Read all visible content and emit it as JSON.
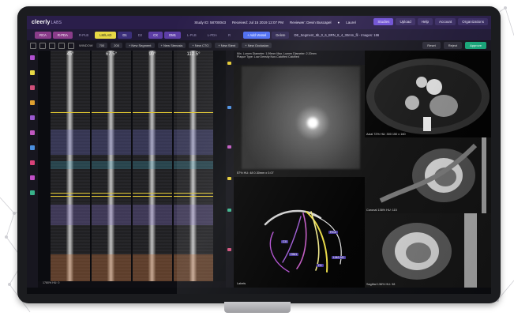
{
  "app": {
    "logo": "cleerly",
    "logo_suffix": "LABS",
    "study": "Study ID: 58700043",
    "received": "Received: Jul 15 2019 12:07 PM",
    "reviewer": "Reviewer: Devin Buscapel",
    "user": "Laurel"
  },
  "top_buttons": [
    "Studies",
    "Upload",
    "Help",
    "Account",
    "Organizations"
  ],
  "vessel_tabs": [
    "RCA",
    "R-PDA",
    "R-PLB",
    "LM/LAD",
    "D1",
    "D2",
    "CX",
    "OM1",
    "L-PLB",
    "L-PDA",
    "R"
  ],
  "tab_actions": {
    "add_vessel": "+ Add Vessel",
    "delete": "Delete",
    "series": "DE_Segment_6b_0_6_BRN_8_4_30mm_fil - Images: 186"
  },
  "toolbar": {
    "window": "WINDOW",
    "w": "700",
    "l": "200",
    "actions": [
      "+ New Segment",
      "+ New Stenosis",
      "+ New CTO",
      "+ New Stent",
      "+ New Occlusion"
    ],
    "right": [
      "Reset",
      "Reject",
      "Approve"
    ]
  },
  "cpr": {
    "angles": [
      "45°",
      "67.5°",
      "90°",
      "112.5°"
    ],
    "footer": "1780% HU: 0"
  },
  "cross_section": {
    "line1": "Min. Lumen Diameter: 1.99mm   Max. Lumen Diameter: 2.20mm",
    "line2": "Plaque Type:  Low Density   Non-Calcified   Calcified",
    "footer": "57%  HU: 48   0.30mm x 0.07"
  },
  "tree": {
    "labels": [
      "RCA",
      "LM/LAD",
      "CX",
      "OM1",
      "D1"
    ],
    "footer": "Labels"
  },
  "axial": {
    "caption": "Axial   72%  HU: 300   150 x 160"
  },
  "coronal": {
    "caption": "Coronal   136%  HU: 115"
  },
  "sagittal": {
    "caption": "Sagittal   136%  HU: 98"
  },
  "colors": {
    "accent": "#6d4fd3",
    "approve": "#18a87a",
    "highlight": "#e3c931"
  }
}
